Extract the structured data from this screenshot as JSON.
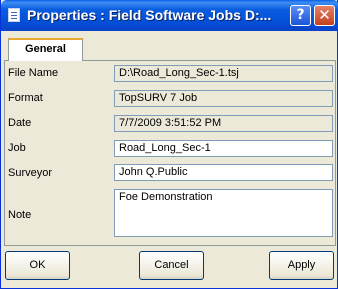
{
  "window": {
    "title": "Properties : Field Software Jobs D:...",
    "help_glyph": "?",
    "close_glyph": "✕"
  },
  "tabs": [
    {
      "label": "General",
      "selected": true
    }
  ],
  "fields": {
    "file_name": {
      "label": "File Name",
      "value": "D:\\Road_Long_Sec-1.tsj"
    },
    "format": {
      "label": "Format",
      "value": "TopSURV 7 Job"
    },
    "date": {
      "label": "Date",
      "value": "7/7/2009 3:51:52 PM"
    },
    "job": {
      "label": "Job",
      "value": "Road_Long_Sec-1"
    },
    "surveyor": {
      "label": "Surveyor",
      "value": "John Q.Public"
    },
    "note": {
      "label": "Note",
      "value": "Foe Demonstration"
    }
  },
  "buttons": {
    "ok": "OK",
    "cancel": "Cancel",
    "apply": "Apply"
  },
  "colors": {
    "titlebar": "#0450d8",
    "dialog_bg": "#ece9d8",
    "field_border": "#7f9db9",
    "tab_accent": "#e9a82f"
  }
}
